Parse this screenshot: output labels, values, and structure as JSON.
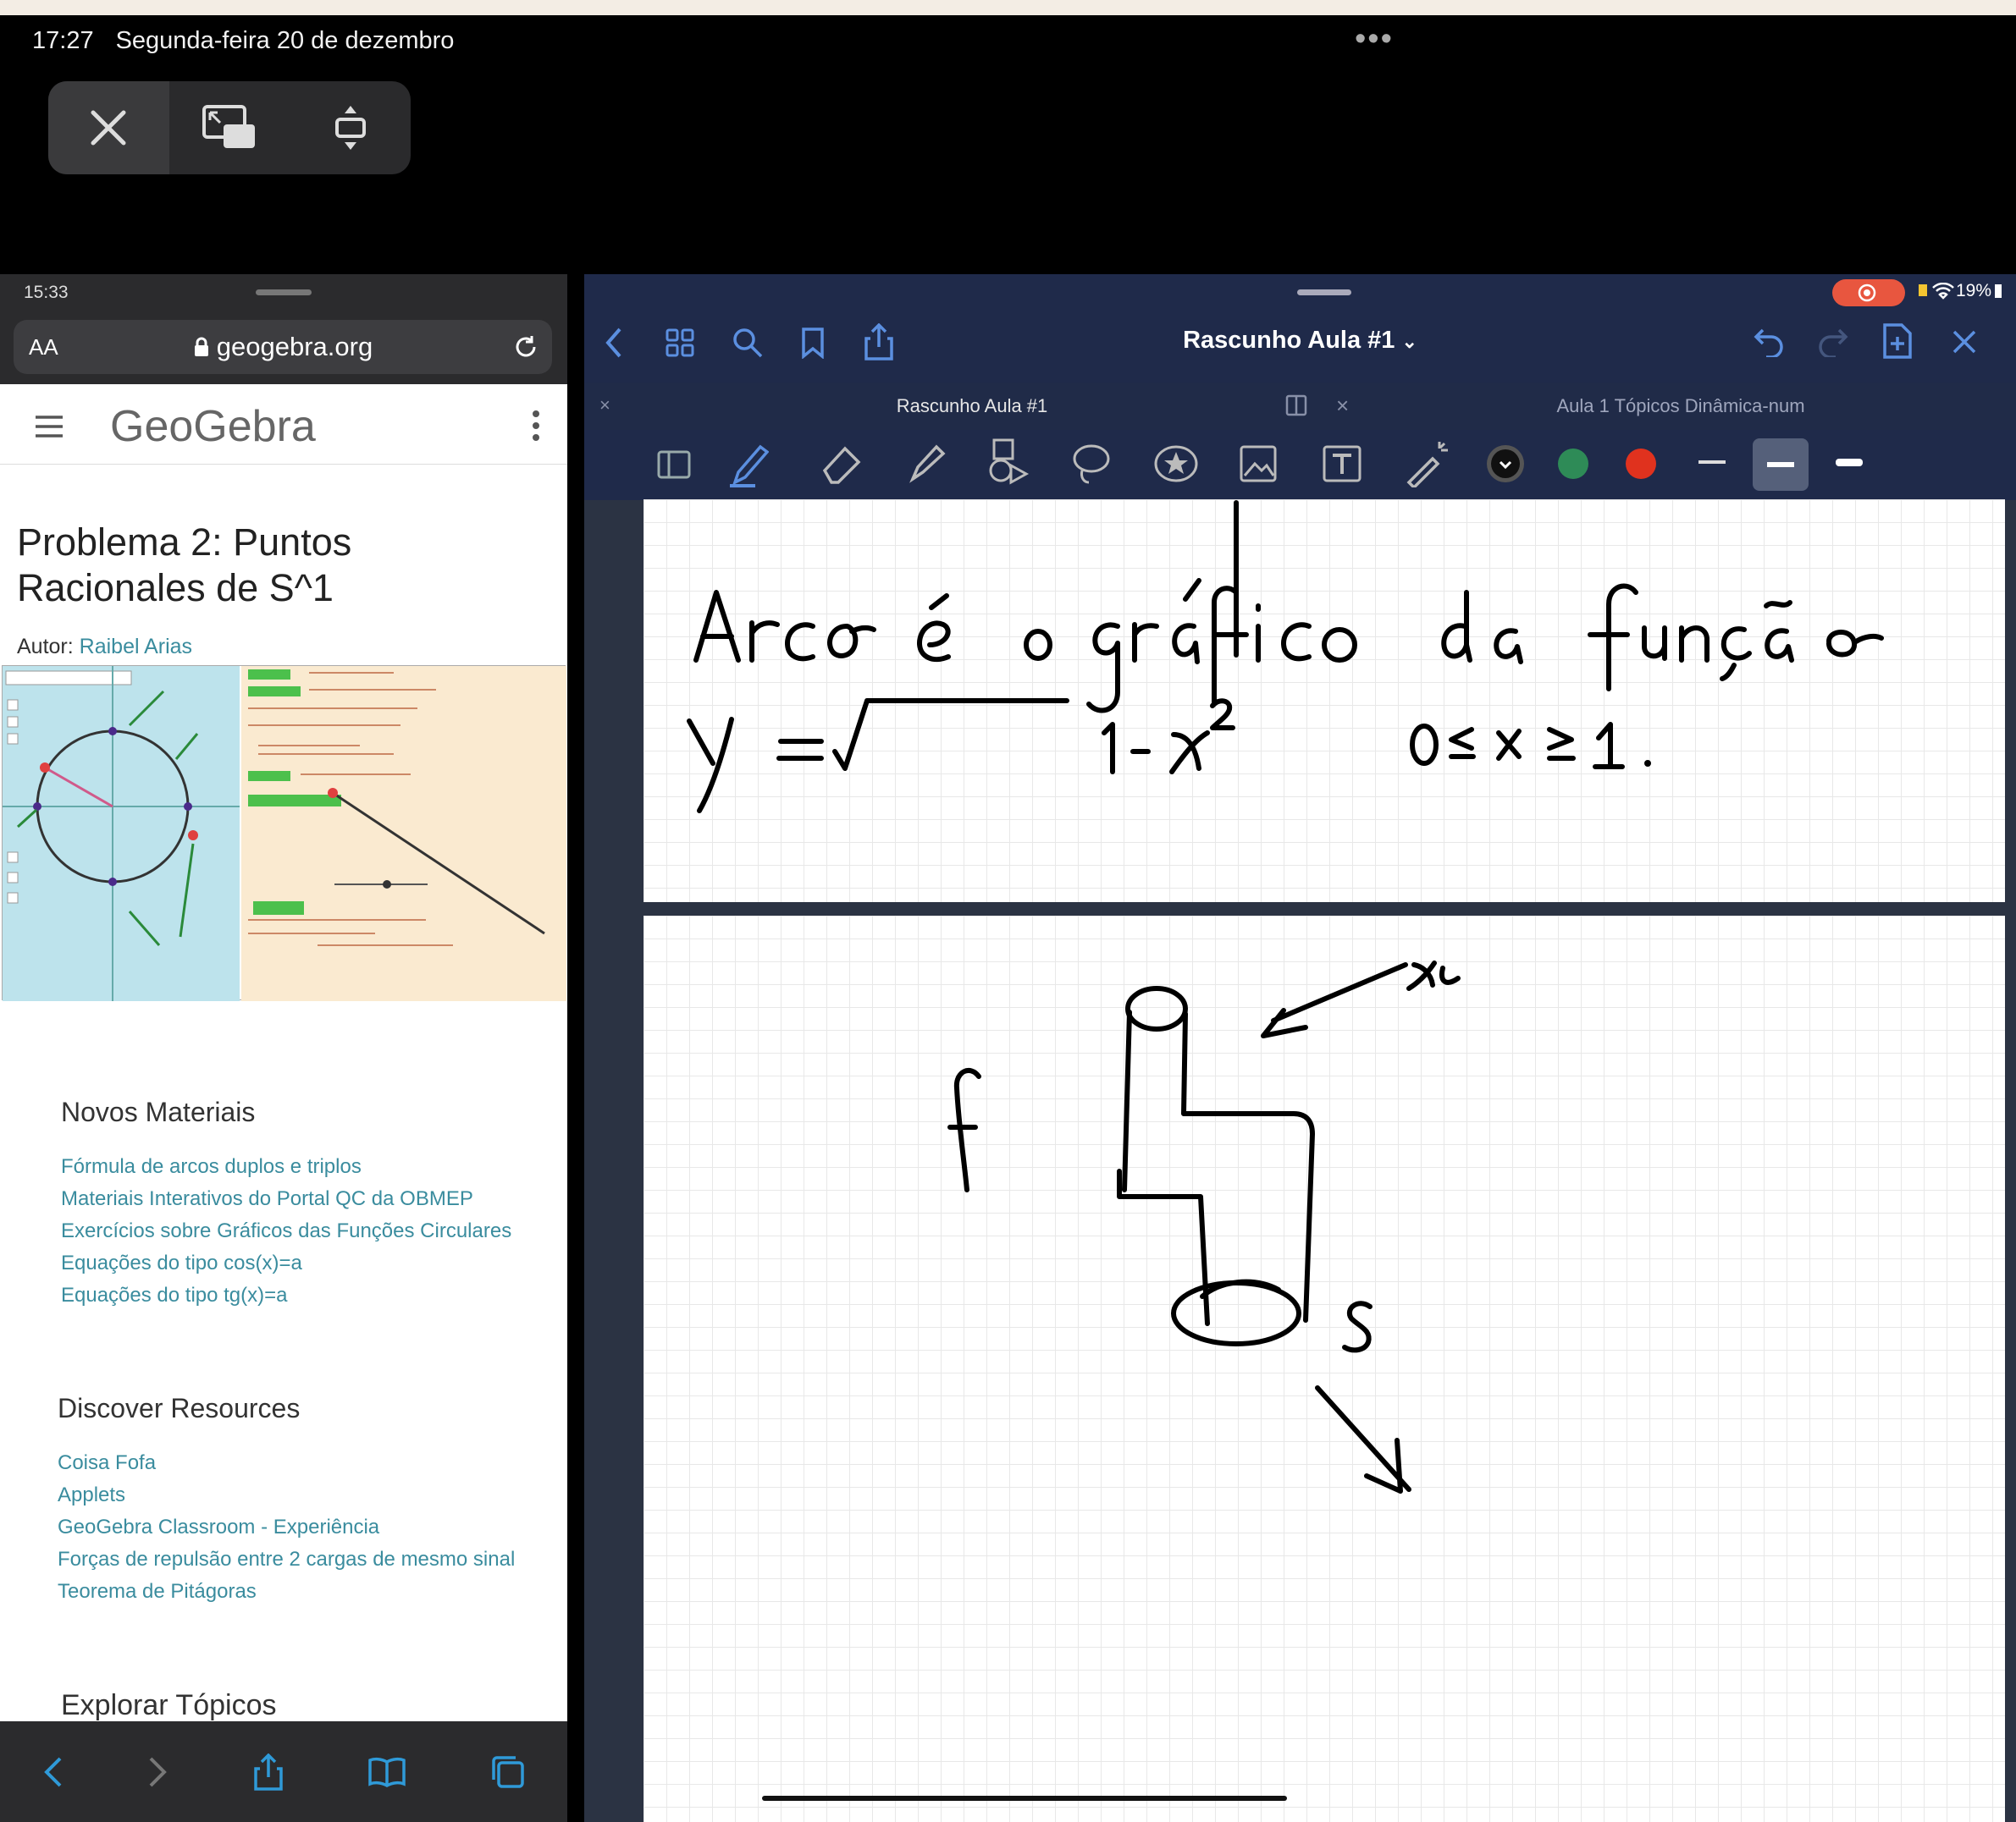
{
  "ipad_status": {
    "time": "17:27",
    "date": "Segunda-feira 20 de dezembro"
  },
  "browser": {
    "status_time": "15:33",
    "text_size_label": "AA",
    "url": "geogebra.org",
    "logo": "GeoGebra",
    "title_line1": "Problema 2: Puntos",
    "title_line2": "Racionales de S^1",
    "author_label": "Autor:",
    "author_name": "Raibel Arias",
    "new_materials": {
      "heading": "Novos Materiais",
      "items": [
        "Fórmula de arcos duplos e triplos",
        "Materiais Interativos do Portal QC da OBMEP",
        "Exercícios sobre Gráficos das Funções Circulares",
        "Equações do tipo cos(x)=a",
        "Equações do tipo tg(x)=a"
      ]
    },
    "discover": {
      "heading": "Discover Resources",
      "items": [
        "Coisa Fofa",
        "Applets",
        "GeoGebra Classroom - Experiência",
        "Forças de repulsão entre 2 cargas de mesmo sinal",
        "Teorema de Pitágoras"
      ]
    },
    "explore_heading": "Explorar Tópicos"
  },
  "notes": {
    "battery": "19%",
    "document_title": "Rascunho Aula #1",
    "tabs": [
      "Rascunho Aula #1",
      "Aula 1 Tópicos Dinâmica-num"
    ],
    "colors": {
      "black": "#111111",
      "green": "#2e8b57",
      "red": "#e0321e",
      "toolbar": "#1f2a4a"
    },
    "page1_text": {
      "line1": "Arco é o gráfico da função",
      "line2": "y = √(1 - x²)   0≤x≤1."
    }
  }
}
